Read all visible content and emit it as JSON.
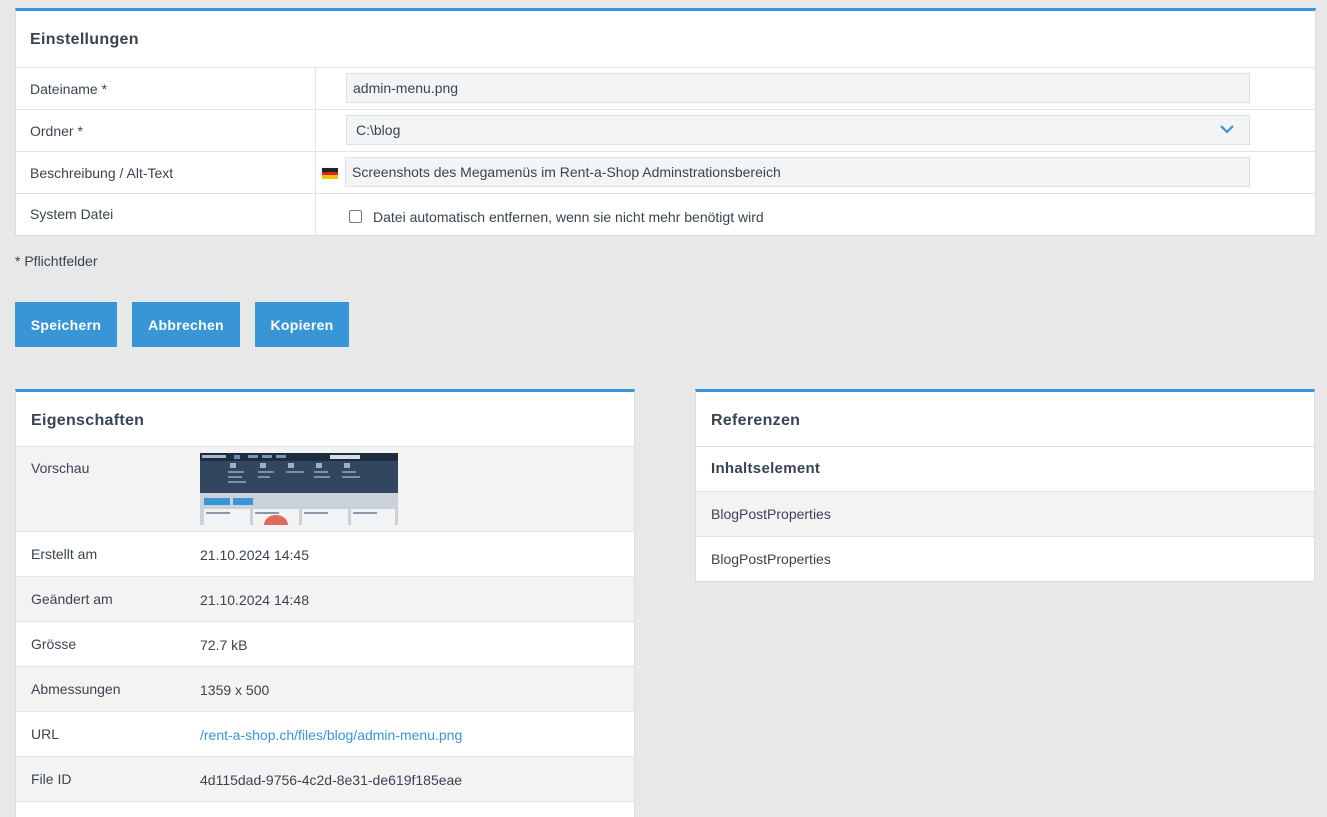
{
  "settings": {
    "title": "Einstellungen",
    "filename_label": "Dateiname *",
    "filename_value": "admin-menu.png",
    "folder_label": "Ordner *",
    "folder_value": "C:\\blog",
    "description_label": "Beschreibung / Alt-Text",
    "description_value": "Screenshots des Megamenüs im Rent-a-Shop Adminstrationsbereich",
    "system_label": "System Datei",
    "system_checkbox_label": "Datei automatisch entfernen, wenn sie nicht mehr benötigt wird"
  },
  "required_note": "* Pflichtfelder",
  "buttons": {
    "save": "Speichern",
    "cancel": "Abbrechen",
    "copy": "Kopieren"
  },
  "properties": {
    "title": "Eigenschaften",
    "preview_label": "Vorschau",
    "created_label": "Erstellt am",
    "created_value": "21.10.2024 14:45",
    "modified_label": "Geändert am",
    "modified_value": "21.10.2024 14:48",
    "size_label": "Grösse",
    "size_value": "72.7 kB",
    "dimensions_label": "Abmessungen",
    "dimensions_value": "1359 x 500",
    "url_label": "URL",
    "url_value": "/rent-a-shop.ch/files/blog/admin-menu.png",
    "fileid_label": "File ID",
    "fileid_value": "4d115dad-9756-4c2d-8e31-de619f185eae"
  },
  "references": {
    "title": "Referenzen",
    "group_label": "Inhaltselement",
    "items": [
      "BlogPostProperties",
      "BlogPostProperties"
    ]
  },
  "colors": {
    "accent": "#3896d6",
    "background": "#e8e8e8"
  }
}
